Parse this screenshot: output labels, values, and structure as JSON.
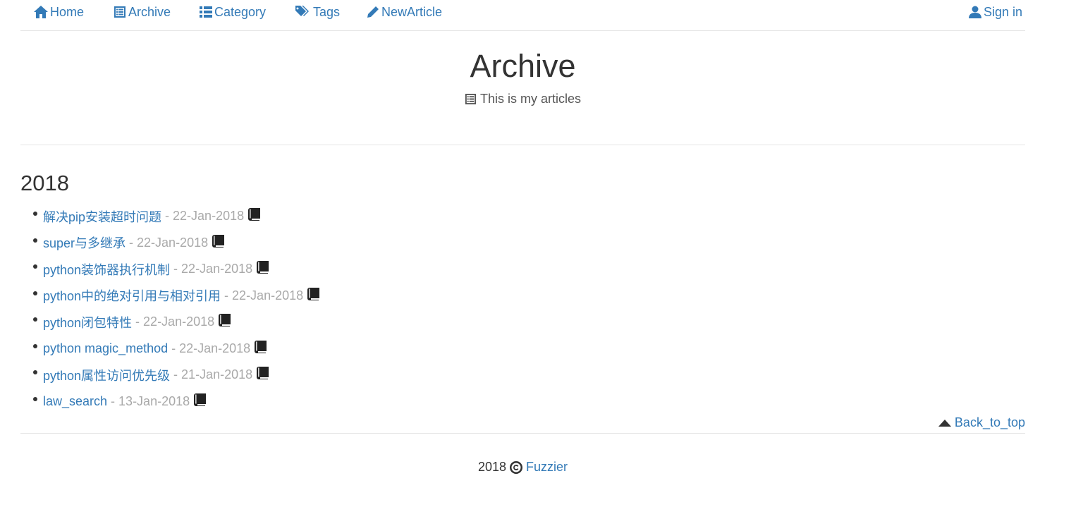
{
  "nav": {
    "home": "Home",
    "archive": "Archive",
    "category": "Category",
    "tags": "Tags",
    "new_article": "NewArticle",
    "sign_in": "Sign in"
  },
  "header": {
    "title": "Archive",
    "subtitle": "This is my articles"
  },
  "archive": {
    "year": "2018",
    "items": [
      {
        "title": "解决pip安装超时问题",
        "date": "- 22-Jan-2018",
        "icon": "book-icon"
      },
      {
        "title": "super与多继承",
        "date": "- 22-Jan-2018",
        "icon": "book-icon"
      },
      {
        "title": "python装饰器执行机制",
        "date": "- 22-Jan-2018",
        "icon": "book-icon"
      },
      {
        "title": "python中的绝对引用与相对引用",
        "date": "- 22-Jan-2018",
        "icon": "book-icon"
      },
      {
        "title": "python闭包特性",
        "date": "- 22-Jan-2018",
        "icon": "book-icon"
      },
      {
        "title": "python magic_method",
        "date": "- 22-Jan-2018",
        "icon": "book-icon"
      },
      {
        "title": "python属性访问优先级",
        "date": "- 21-Jan-2018",
        "icon": "book-icon"
      },
      {
        "title": "law_search",
        "date": "- 13-Jan-2018",
        "icon": "book-icon"
      }
    ]
  },
  "back_to_top": "Back_to_top",
  "footer": {
    "year": "2018",
    "author": "Fuzzier"
  },
  "colors": {
    "link": "#337ab7",
    "date": "#a9a9a9",
    "text": "#333333",
    "divider": "#e5e5e5"
  }
}
